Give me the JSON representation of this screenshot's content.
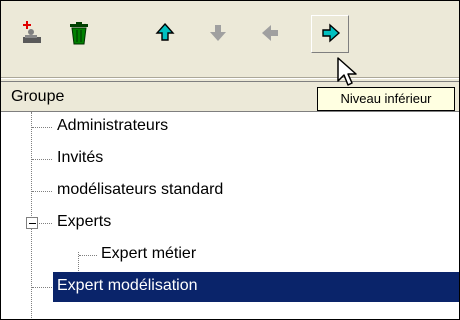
{
  "toolbar": {
    "buttons": [
      {
        "name": "add-user-button",
        "icon": "add-user-icon"
      },
      {
        "name": "delete-button",
        "icon": "trash-icon"
      },
      {
        "name": "move-up-button",
        "icon": "arrow-up-icon"
      },
      {
        "name": "move-down-button",
        "icon": "arrow-down-icon"
      },
      {
        "name": "move-left-button",
        "icon": "arrow-left-icon"
      },
      {
        "name": "move-right-button",
        "icon": "arrow-right-icon",
        "pressed": true
      }
    ],
    "tooltip": "Niveau inférieur"
  },
  "tree": {
    "header": "Groupe",
    "items": [
      {
        "label": "Administrateurs",
        "level": 1
      },
      {
        "label": "Invités",
        "level": 1
      },
      {
        "label": "modélisateurs standard",
        "level": 1
      },
      {
        "label": "Experts",
        "level": 1,
        "expanded": true
      },
      {
        "label": "Expert métier",
        "level": 2
      },
      {
        "label": "Expert modélisation",
        "level": 1,
        "selected": true
      }
    ]
  },
  "colors": {
    "selection": "#0a246a",
    "arrow_active": "#00c0c0",
    "arrow_disabled": "#a0a0a0",
    "tooltip_bg": "#ffffe1",
    "trash_green": "#008000"
  }
}
